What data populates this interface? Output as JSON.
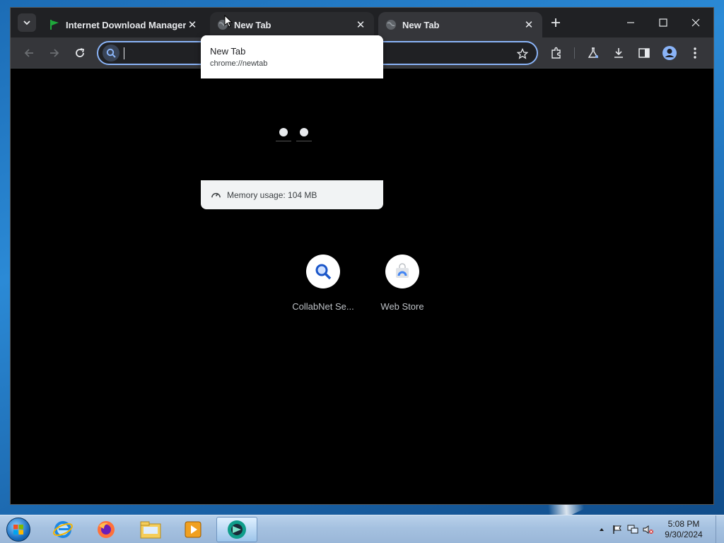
{
  "browser": {
    "tabs": [
      {
        "title": "Internet Download Manager is",
        "favicon": "green-flag-icon",
        "state": "inactive"
      },
      {
        "title": "New Tab",
        "favicon": "globe-icon",
        "state": "hovered"
      },
      {
        "title": "New Tab",
        "favicon": "globe-icon",
        "state": "active"
      }
    ],
    "omnibox": {
      "value": "",
      "placeholder": ""
    },
    "accent": "#8ab4f8"
  },
  "hovercard": {
    "title": "New Tab",
    "url": "chrome://newtab",
    "memory": "Memory usage: 104 MB"
  },
  "shortcuts": [
    {
      "label": "CollabNet Se...",
      "icon": "search-icon"
    },
    {
      "label": "Web Store",
      "icon": "web-store-icon"
    }
  ],
  "taskbar": {
    "apps": [
      "internet-explorer-icon",
      "firefox-icon",
      "file-explorer-icon",
      "media-player-icon",
      "chrome-app-icon"
    ],
    "clock": {
      "time": "5:08 PM",
      "date": "9/30/2024"
    }
  }
}
